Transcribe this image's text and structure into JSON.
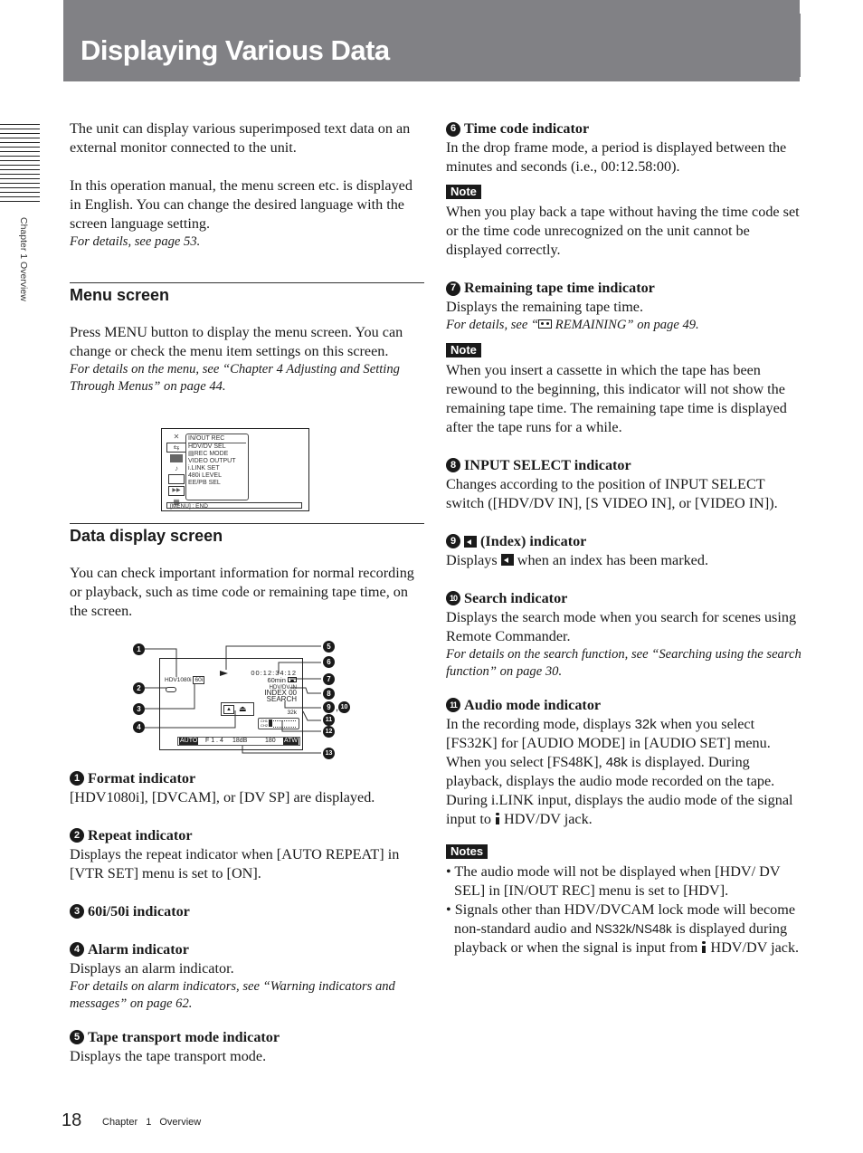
{
  "header": {
    "title": "Displaying Various Data"
  },
  "side_tab": {
    "label": "Chapter 1 Overview"
  },
  "intro": {
    "p1": "The unit can display various superimposed text data on an external monitor connected to the unit.",
    "p2": "In this operation manual, the menu screen etc. is displayed in English. You can change the desired language with the screen language setting.",
    "p2_ref": "For details, see page 53."
  },
  "menu_section": {
    "title": "Menu screen",
    "body": "Press MENU button to display the menu screen. You can change or check the menu item settings on this screen.",
    "ref": "For details on the menu, see “Chapter 4 Adjusting and Setting Through Menus” on page 44.",
    "figure": {
      "icons": [
        "settings-icon",
        "in-out-icon",
        "screen-icon",
        "audio-icon",
        "tape-icon",
        "dots-icon",
        "grid-icon"
      ],
      "header": "IN/OUT REC",
      "items": [
        "HDV/DV SEL",
        "▤REC MODE",
        "VIDEO OUTPUT",
        "i.LINK SET",
        "480i LEVEL",
        "EE/PB SEL"
      ],
      "footer": "[MENU] : END"
    }
  },
  "data_section": {
    "title": "Data display screen",
    "body": "You can check important information for normal recording or playback, such as time code or remaining tape time, on the screen.",
    "figure": {
      "format": "HDV1080i",
      "rate": "60i",
      "timecode": "00:12:34:12",
      "remaining": "60min",
      "input": "HDV/DV IN",
      "index": "INDEX  00",
      "search": "SEARCH",
      "audio": "32k",
      "ch_labels": [
        "CH1",
        "CH2"
      ],
      "bar": {
        "auto": "AUTO",
        "iris": "F 1 . 4",
        "gain": "18dB",
        "shutter": "180",
        "wb": "ATW"
      },
      "callouts": [
        "1",
        "2",
        "3",
        "4",
        "5",
        "6",
        "7",
        "8",
        "9",
        "10",
        "11",
        "12",
        "13"
      ]
    }
  },
  "items": [
    {
      "num": "1",
      "title": "Format indicator",
      "body": "[HDV1080i], [DVCAM], or [DV SP] are displayed."
    },
    {
      "num": "2",
      "title": "Repeat indicator",
      "body": "Displays the repeat indicator when [AUTO REPEAT] in [VTR SET] menu is set to [ON]."
    },
    {
      "num": "3",
      "title": "60i/50i indicator"
    },
    {
      "num": "4",
      "title": "Alarm indicator",
      "body": "Displays an alarm indicator.",
      "ref": "For details on alarm indicators, see “Warning indicators and messages” on page 62."
    },
    {
      "num": "5",
      "title": "Tape transport mode indicator",
      "body": "Displays the tape transport mode."
    },
    {
      "num": "6",
      "title": "Time code indicator",
      "body": "In the drop frame mode, a period is displayed between the minutes and seconds (i.e., 00:12.58:00).",
      "note_label": "Note",
      "note": "When you play back a tape without having the time code set or the time code unrecognized on the unit cannot be displayed correctly."
    },
    {
      "num": "7",
      "title": "Remaining tape time indicator",
      "body": "Displays the remaining tape time.",
      "ref_pre": "For details, see “",
      "ref_post": " REMAINING” on page 49.",
      "note_label": "Note",
      "note": "When you insert a cassette in which the tape has been rewound to the beginning, this indicator will not show the remaining tape time. The remaining tape time is displayed after the tape runs for a while."
    },
    {
      "num": "8",
      "title": "INPUT SELECT indicator",
      "body": "Changes according to the position of INPUT SELECT switch ([HDV/DV IN], [S VIDEO IN], or [VIDEO IN])."
    },
    {
      "num": "9",
      "title": "(Index) indicator",
      "body_pre": "Displays ",
      "body_post": " when an index has been marked."
    },
    {
      "num": "10",
      "title": "Search indicator",
      "body": "Displays the search mode when you search for scenes using Remote Commander.",
      "ref": "For details on the search function, see “Searching using the search function” on page 30."
    },
    {
      "num": "11",
      "title": "Audio mode indicator",
      "body_a": "In the recording mode, displays ",
      "sym_a": "32k",
      "body_b": " when you select [FS32K] for [AUDIO MODE] in [AUDIO SET] menu. When you select [FS48K], ",
      "sym_b": "48k",
      "body_c": " is displayed. During playback, displays the audio mode recorded on the tape. During i.LINK input, displays the audio mode of the signal input to ",
      "body_d": " HDV/DV jack.",
      "notes_label": "Notes",
      "note1": "• The audio mode will not be displayed when [HDV/ DV SEL] in [IN/OUT REC] menu is set to [HDV].",
      "note2_a": "• Signals other than HDV/DVCAM lock mode will become non-standard audio and ",
      "note2_sym": "NS32k/NS48k",
      "note2_b": " is displayed during playback or when the signal is input from ",
      "note2_c": " HDV/DV jack."
    }
  ],
  "footer": {
    "page": "18",
    "chapter": "Chapter 1 Overview"
  }
}
